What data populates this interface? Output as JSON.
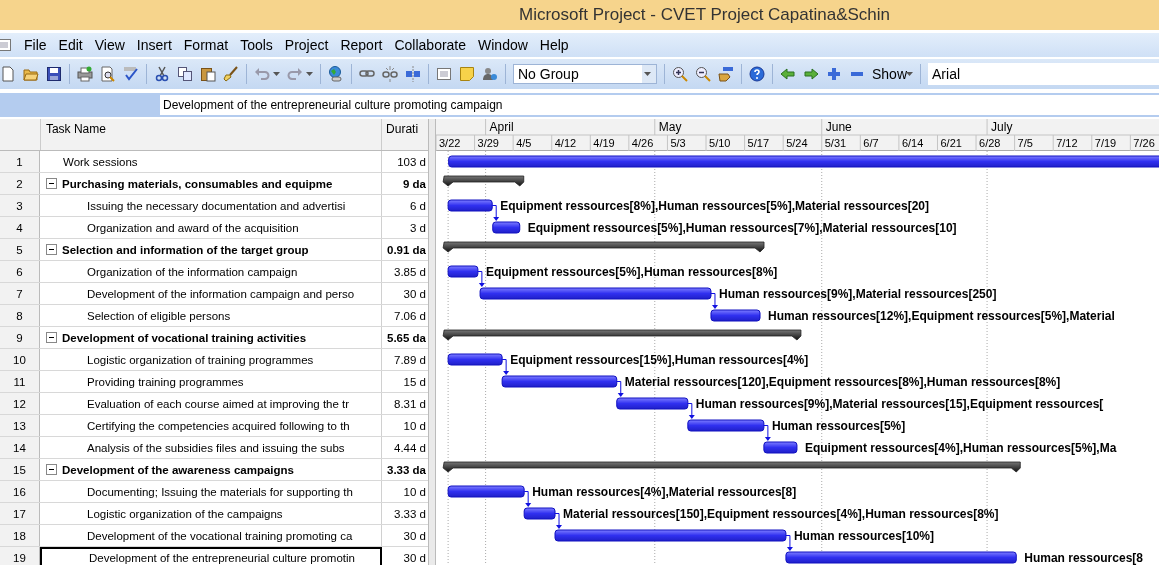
{
  "window": {
    "title": "Microsoft Project - CVET Project Capatina&Schin"
  },
  "menu": [
    "File",
    "Edit",
    "View",
    "Insert",
    "Format",
    "Tools",
    "Project",
    "Report",
    "Collaborate",
    "Window",
    "Help"
  ],
  "toolbar": {
    "group_select": "No Group",
    "show_button": "Show",
    "font_field": "Arial"
  },
  "entry_bar": {
    "value": "Development of the entrepreneurial culture promoting campaign"
  },
  "table": {
    "columns": [
      "Task Name",
      "Durati"
    ],
    "rows": [
      {
        "id": "1",
        "name": "Work sessions",
        "duration": "103 d",
        "kind": "task",
        "selected": false
      },
      {
        "id": "2",
        "name": "Purchasing materials, consumables and equipme",
        "duration": "9 da",
        "kind": "summary",
        "expanded": true,
        "selected": false,
        "children": [
          {
            "id": "3",
            "name": "Issuing the necessary documentation and advertisi",
            "duration": "6 d",
            "kind": "task",
            "selected": false
          },
          {
            "id": "4",
            "name": "Organization and award of the acquisition",
            "duration": "3 d",
            "kind": "task",
            "selected": false
          }
        ]
      },
      {
        "id": "5",
        "name": "Selection and information of the target group",
        "duration": "0.91 da",
        "kind": "summary",
        "expanded": true,
        "selected": false,
        "children": [
          {
            "id": "6",
            "name": "Organization of the information campaign",
            "duration": "3.85 d",
            "kind": "task",
            "selected": false
          },
          {
            "id": "7",
            "name": "Development of the information campaign and perso",
            "duration": "30 d",
            "kind": "task",
            "selected": false
          },
          {
            "id": "8",
            "name": "Selection of eligible persons",
            "duration": "7.06 d",
            "kind": "task",
            "selected": false
          }
        ]
      },
      {
        "id": "9",
        "name": "Development of vocational training activities",
        "duration": "5.65 da",
        "kind": "summary",
        "expanded": true,
        "selected": false,
        "children": [
          {
            "id": "10",
            "name": "Logistic organization of training programmes",
            "duration": "7.89 d",
            "kind": "task",
            "selected": false
          },
          {
            "id": "11",
            "name": "Providing training programmes",
            "duration": "15 d",
            "kind": "task",
            "selected": false
          },
          {
            "id": "12",
            "name": "Evaluation of each course aimed at improving the tr",
            "duration": "8.31 d",
            "kind": "task",
            "selected": false
          },
          {
            "id": "13",
            "name": "Certifying the competencies acquired following to th",
            "duration": "10 d",
            "kind": "task",
            "selected": false
          },
          {
            "id": "14",
            "name": "Analysis of the subsidies files and issuing the subs",
            "duration": "4.44 d",
            "kind": "task",
            "selected": false
          }
        ]
      },
      {
        "id": "15",
        "name": "Development of the awareness campaigns",
        "duration": "3.33 da",
        "kind": "summary",
        "expanded": true,
        "selected": false,
        "children": [
          {
            "id": "16",
            "name": "Documenting; Issuing the materials for supporting th",
            "duration": "10 d",
            "kind": "task",
            "selected": false
          },
          {
            "id": "17",
            "name": "Logistic organization of the campaigns",
            "duration": "3.33 d",
            "kind": "task",
            "selected": false
          },
          {
            "id": "18",
            "name": "Development of the vocational training promoting ca",
            "duration": "30 d",
            "kind": "task",
            "selected": false
          },
          {
            "id": "19",
            "name": "Development of the entrepreneurial culture promotin",
            "duration": "30 d",
            "kind": "task",
            "selected": true
          }
        ]
      }
    ]
  },
  "gantt": {
    "months": [
      "April",
      "May",
      "June",
      "July"
    ],
    "weeks": [
      "3/22",
      "3/29",
      "4/5",
      "4/12",
      "4/19",
      "4/26",
      "5/3",
      "5/10",
      "5/17",
      "5/24",
      "5/31",
      "6/7",
      "6/14",
      "6/21",
      "6/28",
      "7/5",
      "7/12",
      "7/19",
      "7/26"
    ],
    "bars": [
      {
        "kind": "task"
      },
      {
        "kind": "summary"
      },
      {
        "kind": "task",
        "resources": "Equipment ressources[8%],Human ressources[5%],Material ressources[20]"
      },
      {
        "kind": "task",
        "resources": "Equipment ressources[5%],Human ressources[7%],Material ressources[10]"
      },
      {
        "kind": "summary"
      },
      {
        "kind": "task",
        "resources": "Equipment ressources[5%],Human ressources[8%]"
      },
      {
        "kind": "task",
        "resources": "Human ressources[9%],Material ressources[250]"
      },
      {
        "kind": "task",
        "resources": "Human ressources[12%],Equipment ressources[5%],Material"
      },
      {
        "kind": "summary"
      },
      {
        "kind": "task",
        "resources": "Equipment ressources[15%],Human ressources[4%]"
      },
      {
        "kind": "task",
        "resources": "Material ressources[120],Equipment ressources[8%],Human ressources[8%]"
      },
      {
        "kind": "task",
        "resources": "Human ressources[9%],Material ressources[15],Equipment ressources["
      },
      {
        "kind": "task",
        "resources": "Human ressources[5%]"
      },
      {
        "kind": "task",
        "resources": "Equipment ressources[4%],Human ressources[5%],Ma"
      },
      {
        "kind": "summary"
      },
      {
        "kind": "task",
        "resources": "Human ressources[4%],Material ressources[8]"
      },
      {
        "kind": "task",
        "resources": "Material ressources[150],Equipment ressources[4%],Human ressources[8%]"
      },
      {
        "kind": "task",
        "resources": "Human ressources[10%]"
      },
      {
        "kind": "task",
        "resources": "Human ressources[8"
      }
    ]
  }
}
